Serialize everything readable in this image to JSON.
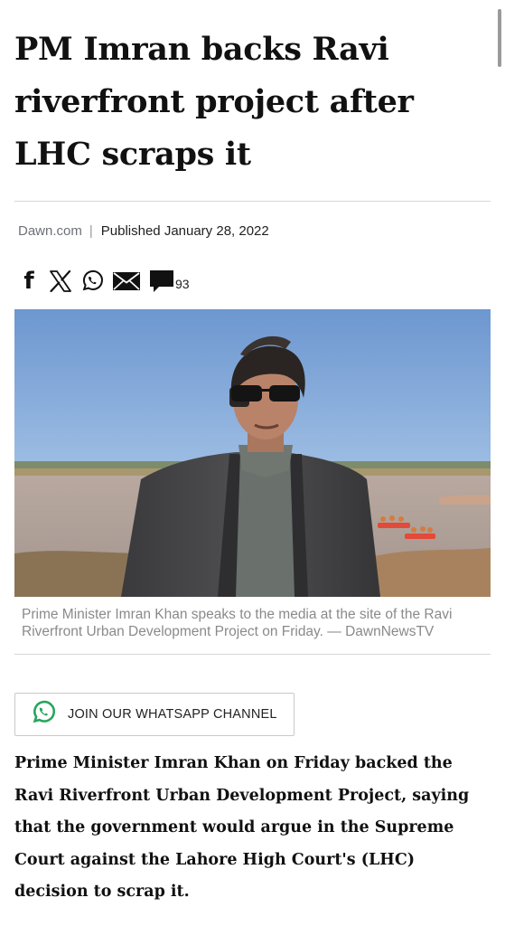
{
  "article": {
    "headline": "PM Imran backs Ravi riverfront project after LHC scraps it",
    "source": "Dawn.com",
    "separator": "|",
    "published": "Published January 28, 2022",
    "caption": "Prime Minister Imran Khan speaks to the media at the site of the Ravi Riverfront Urban Development Project on Friday. — DawnNewsTV",
    "lead": "Prime Minister Imran Khan on Friday backed the Ravi Riverfront Urban Development Project, saying that the government would argue in the Supreme Court against the Lahore High Court's (LHC) decision to scrap it."
  },
  "share": {
    "facebook_glyph": "f",
    "comment_count": "93",
    "icons": [
      "facebook-icon",
      "x-icon",
      "whatsapp-icon",
      "email-icon",
      "comment-icon"
    ]
  },
  "whatsapp": {
    "label": "JOIN OUR WHATSAPP CHANNEL",
    "color": "#25a55b"
  }
}
